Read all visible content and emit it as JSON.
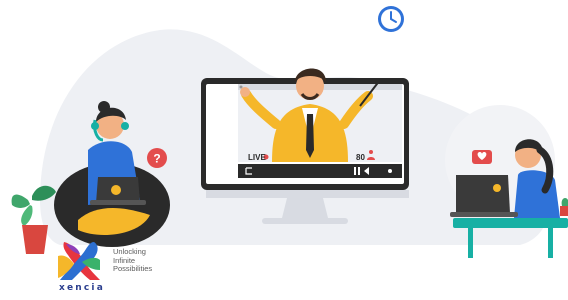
{
  "video": {
    "live_label": "LIVE",
    "viewer_count": "80"
  },
  "brand": {
    "name": "xencia",
    "tagline_lines": [
      "Unlocking",
      "Infinite",
      "Possibilities"
    ]
  },
  "icons": [
    "clock-icon",
    "question-icon",
    "heart-icon",
    "play-icon",
    "pause-icon",
    "volume-icon",
    "fullscreen-icon",
    "user-icon"
  ],
  "colors": {
    "teal": "#17b0a4",
    "blue": "#2f72d8",
    "yellow": "#f5b72a",
    "red": "#e34c4c",
    "dark": "#2a2a2a"
  }
}
